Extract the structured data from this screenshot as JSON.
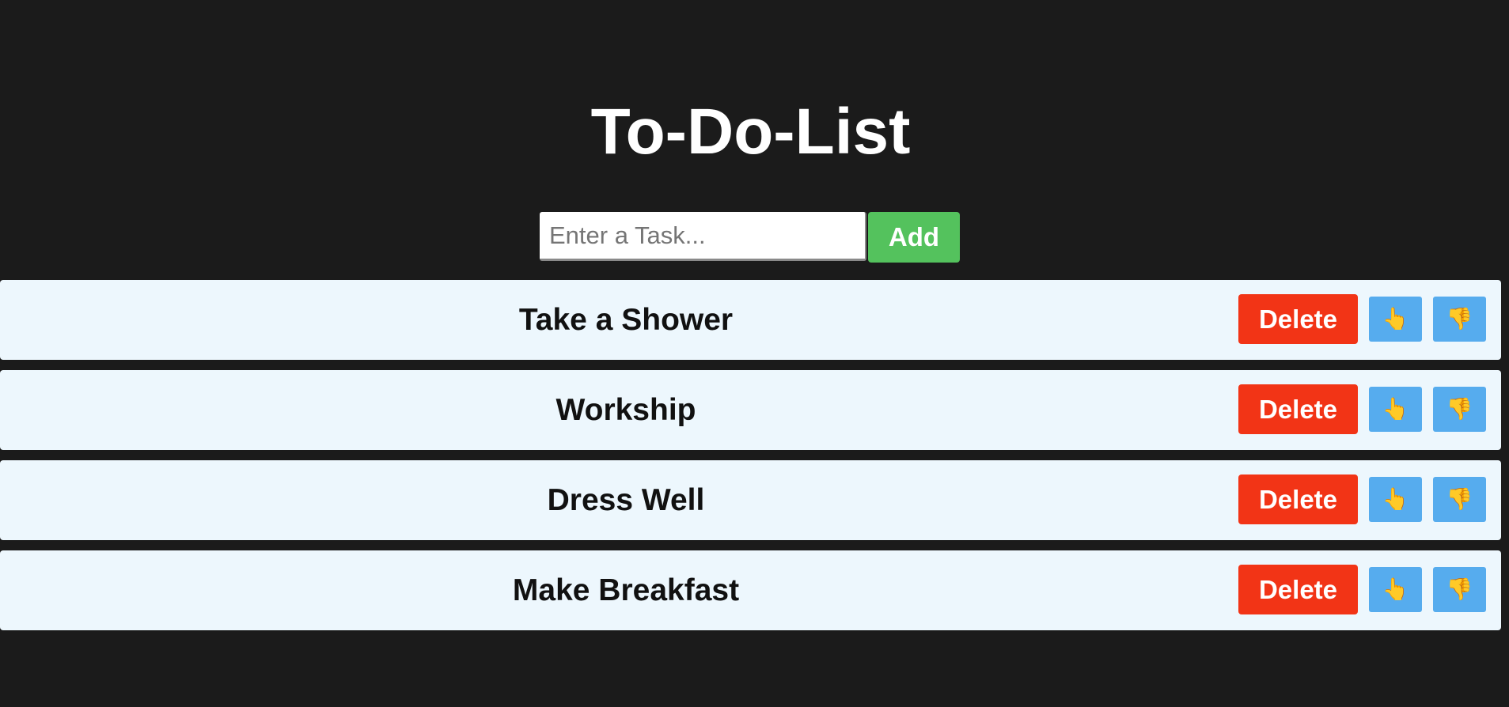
{
  "app": {
    "title": "To-Do-List"
  },
  "input": {
    "placeholder": "Enter a Task...",
    "value": ""
  },
  "add_button": {
    "label": "Add"
  },
  "tasks": [
    {
      "label": "Take a Shower",
      "delete_label": "Delete",
      "up_icon": "👆",
      "down_icon": "👎"
    },
    {
      "label": "Workship",
      "delete_label": "Delete",
      "up_icon": "👆",
      "down_icon": "👎"
    },
    {
      "label": "Dress Well",
      "delete_label": "Delete",
      "up_icon": "👆",
      "down_icon": "👎"
    },
    {
      "label": "Make Breakfast",
      "delete_label": "Delete",
      "up_icon": "👆",
      "down_icon": "👎"
    }
  ],
  "colors": {
    "background": "#1b1b1b",
    "row": "#edf7fd",
    "add": "#54c25d",
    "delete": "#f23416",
    "emoji_button": "#56acee"
  }
}
